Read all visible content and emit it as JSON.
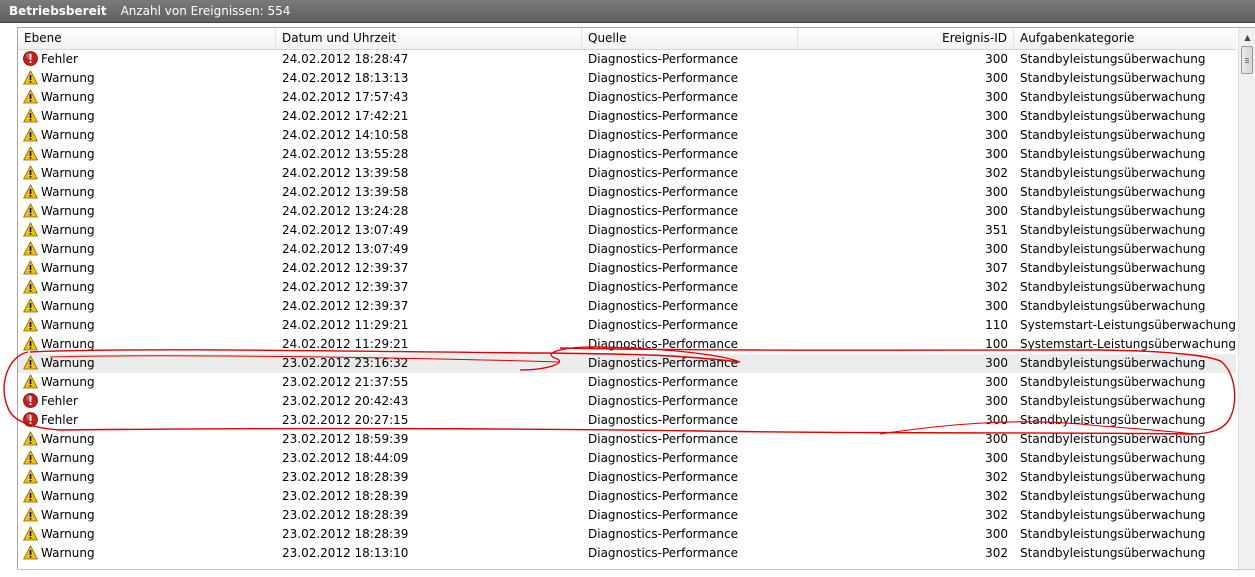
{
  "titlebar": {
    "status": "Betriebsbereit",
    "count_text": "Anzahl von Ereignissen: 554"
  },
  "columns": {
    "level": "Ebene",
    "datetime": "Datum und Uhrzeit",
    "source": "Quelle",
    "id": "Ereignis-ID",
    "category": "Aufgabenkategorie"
  },
  "icons": {
    "error": "error-icon",
    "warning": "warning-icon"
  },
  "colors": {
    "error": "#c41e1e",
    "warning": "#f2c200",
    "annotation": "#e00000"
  },
  "rows": [
    {
      "level": "Fehler",
      "datetime": "24.02.2012 18:28:47",
      "source": "Diagnostics-Performance",
      "id": "300",
      "category": "Standbyleistungsüberwachung"
    },
    {
      "level": "Warnung",
      "datetime": "24.02.2012 18:13:13",
      "source": "Diagnostics-Performance",
      "id": "300",
      "category": "Standbyleistungsüberwachung"
    },
    {
      "level": "Warnung",
      "datetime": "24.02.2012 17:57:43",
      "source": "Diagnostics-Performance",
      "id": "300",
      "category": "Standbyleistungsüberwachung"
    },
    {
      "level": "Warnung",
      "datetime": "24.02.2012 17:42:21",
      "source": "Diagnostics-Performance",
      "id": "300",
      "category": "Standbyleistungsüberwachung"
    },
    {
      "level": "Warnung",
      "datetime": "24.02.2012 14:10:58",
      "source": "Diagnostics-Performance",
      "id": "300",
      "category": "Standbyleistungsüberwachung"
    },
    {
      "level": "Warnung",
      "datetime": "24.02.2012 13:55:28",
      "source": "Diagnostics-Performance",
      "id": "300",
      "category": "Standbyleistungsüberwachung"
    },
    {
      "level": "Warnung",
      "datetime": "24.02.2012 13:39:58",
      "source": "Diagnostics-Performance",
      "id": "302",
      "category": "Standbyleistungsüberwachung"
    },
    {
      "level": "Warnung",
      "datetime": "24.02.2012 13:39:58",
      "source": "Diagnostics-Performance",
      "id": "300",
      "category": "Standbyleistungsüberwachung"
    },
    {
      "level": "Warnung",
      "datetime": "24.02.2012 13:24:28",
      "source": "Diagnostics-Performance",
      "id": "300",
      "category": "Standbyleistungsüberwachung"
    },
    {
      "level": "Warnung",
      "datetime": "24.02.2012 13:07:49",
      "source": "Diagnostics-Performance",
      "id": "351",
      "category": "Standbyleistungsüberwachung"
    },
    {
      "level": "Warnung",
      "datetime": "24.02.2012 13:07:49",
      "source": "Diagnostics-Performance",
      "id": "300",
      "category": "Standbyleistungsüberwachung"
    },
    {
      "level": "Warnung",
      "datetime": "24.02.2012 12:39:37",
      "source": "Diagnostics-Performance",
      "id": "307",
      "category": "Standbyleistungsüberwachung"
    },
    {
      "level": "Warnung",
      "datetime": "24.02.2012 12:39:37",
      "source": "Diagnostics-Performance",
      "id": "302",
      "category": "Standbyleistungsüberwachung"
    },
    {
      "level": "Warnung",
      "datetime": "24.02.2012 12:39:37",
      "source": "Diagnostics-Performance",
      "id": "300",
      "category": "Standbyleistungsüberwachung"
    },
    {
      "level": "Warnung",
      "datetime": "24.02.2012 11:29:21",
      "source": "Diagnostics-Performance",
      "id": "110",
      "category": "Systemstart-Leistungsüberwachung"
    },
    {
      "level": "Warnung",
      "datetime": "24.02.2012 11:29:21",
      "source": "Diagnostics-Performance",
      "id": "100",
      "category": "Systemstart-Leistungsüberwachung"
    },
    {
      "level": "Warnung",
      "datetime": "23.02.2012 23:16:32",
      "source": "Diagnostics-Performance",
      "id": "300",
      "category": "Standbyleistungsüberwachung",
      "selected": true
    },
    {
      "level": "Warnung",
      "datetime": "23.02.2012 21:37:55",
      "source": "Diagnostics-Performance",
      "id": "300",
      "category": "Standbyleistungsüberwachung"
    },
    {
      "level": "Fehler",
      "datetime": "23.02.2012 20:42:43",
      "source": "Diagnostics-Performance",
      "id": "300",
      "category": "Standbyleistungsüberwachung"
    },
    {
      "level": "Fehler",
      "datetime": "23.02.2012 20:27:15",
      "source": "Diagnostics-Performance",
      "id": "300",
      "category": "Standbyleistungsüberwachung"
    },
    {
      "level": "Warnung",
      "datetime": "23.02.2012 18:59:39",
      "source": "Diagnostics-Performance",
      "id": "300",
      "category": "Standbyleistungsüberwachung"
    },
    {
      "level": "Warnung",
      "datetime": "23.02.2012 18:44:09",
      "source": "Diagnostics-Performance",
      "id": "300",
      "category": "Standbyleistungsüberwachung"
    },
    {
      "level": "Warnung",
      "datetime": "23.02.2012 18:28:39",
      "source": "Diagnostics-Performance",
      "id": "302",
      "category": "Standbyleistungsüberwachung"
    },
    {
      "level": "Warnung",
      "datetime": "23.02.2012 18:28:39",
      "source": "Diagnostics-Performance",
      "id": "302",
      "category": "Standbyleistungsüberwachung"
    },
    {
      "level": "Warnung",
      "datetime": "23.02.2012 18:28:39",
      "source": "Diagnostics-Performance",
      "id": "302",
      "category": "Standbyleistungsüberwachung"
    },
    {
      "level": "Warnung",
      "datetime": "23.02.2012 18:28:39",
      "source": "Diagnostics-Performance",
      "id": "300",
      "category": "Standbyleistungsüberwachung"
    },
    {
      "level": "Warnung",
      "datetime": "23.02.2012 18:13:10",
      "source": "Diagnostics-Performance",
      "id": "302",
      "category": "Standbyleistungsüberwachung"
    }
  ]
}
